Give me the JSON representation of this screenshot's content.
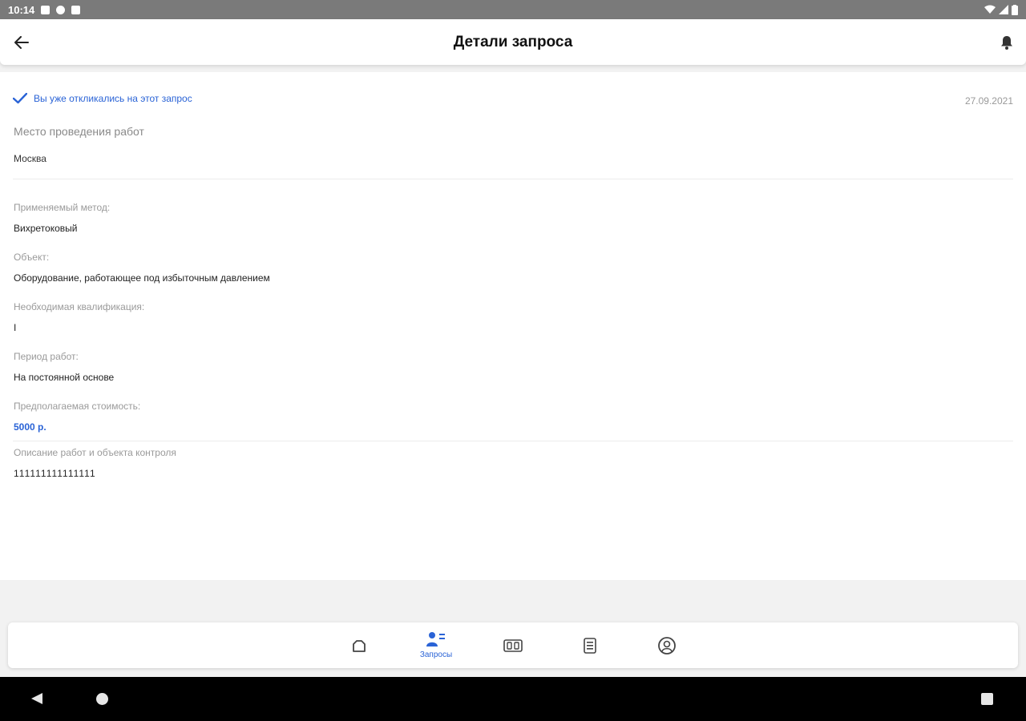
{
  "statusbar": {
    "time": "10:14"
  },
  "appbar": {
    "title": "Детали запроса"
  },
  "request": {
    "responded_text": "Вы уже откликались на этот запрос",
    "date": "27.09.2021",
    "place_label": "Место проведения работ",
    "place_value": "Москва",
    "fields": [
      {
        "label": "Применяемый метод:",
        "value": "Вихретоковый"
      },
      {
        "label": "Объект:",
        "value": "Оборудование, работающее под избыточным давлением"
      },
      {
        "label": "Необходимая квалификация:",
        "value": "I"
      },
      {
        "label": "Период работ:",
        "value": "На постоянной основе"
      },
      {
        "label": "Предполагаемая стоимость:",
        "value": "5000 р."
      }
    ],
    "description_label": "Описание работ и объекта контроля",
    "description_value": "111111111111111"
  },
  "bottom_nav": {
    "items": [
      {
        "icon": "home-icon",
        "label": ""
      },
      {
        "icon": "requests-icon",
        "label": "Запросы",
        "active": true
      },
      {
        "icon": "wallet-icon",
        "label": ""
      },
      {
        "icon": "document-icon",
        "label": ""
      },
      {
        "icon": "profile-icon",
        "label": ""
      }
    ]
  },
  "colors": {
    "accent": "#2a63d6",
    "statusbar": "#7a7a7a",
    "background": "#f2f2f2"
  }
}
